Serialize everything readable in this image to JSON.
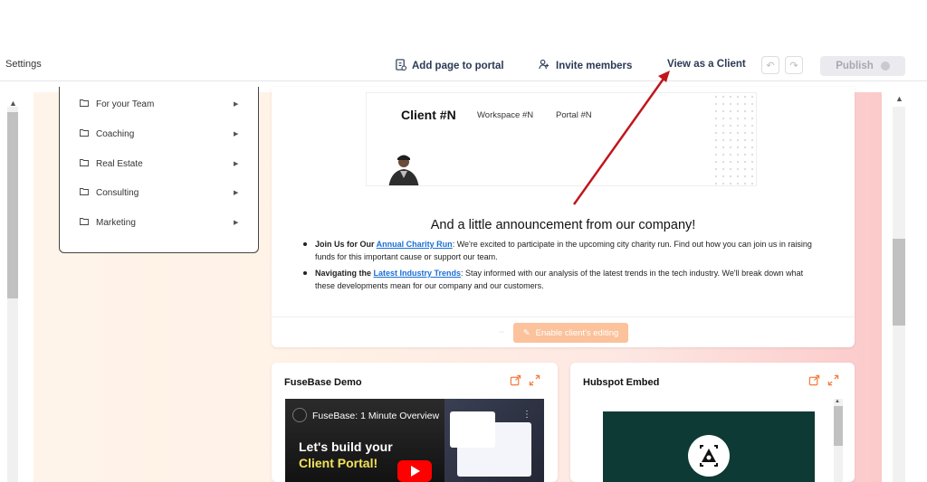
{
  "topbar": {
    "settings": "Settings",
    "add_page": "Add page to portal",
    "invite": "Invite members",
    "view_client": "View as a Client",
    "publish": "Publish"
  },
  "sidebar": {
    "items": [
      {
        "label": "For your Team"
      },
      {
        "label": "Coaching"
      },
      {
        "label": "Real Estate"
      },
      {
        "label": "Consulting"
      },
      {
        "label": "Marketing"
      }
    ]
  },
  "preview": {
    "client": "Client #N",
    "workspace": "Workspace #N",
    "portal": "Portal #N"
  },
  "announcement": {
    "title": "And a little announcement from our company!",
    "b1_lead": "Join Us for Our ",
    "b1_link": "Annual Charity Run",
    "b1_text": ": We're excited to participate in the upcoming city charity run. Find out how you can join us in raising funds for this important cause or support our team.",
    "b2_lead": "Navigating the ",
    "b2_link": "Latest Industry Trends",
    "b2_text": ": Stay informed with our analysis of the latest trends in the tech industry. We'll break down what these developments mean for our company and our customers."
  },
  "editing": {
    "enable": "Enable client's editing"
  },
  "cards": {
    "fusebase": {
      "title": "FuseBase Demo",
      "video_title": "FuseBase: 1 Minute Overview",
      "video_line1": "Let's build your",
      "video_line2": "Client Portal!"
    },
    "hubspot": {
      "title": "Hubspot Embed"
    }
  },
  "colors": {
    "accent_orange": "#f47c3c",
    "arrow_red": "#c0161b",
    "link_blue": "#1a6fd6"
  }
}
